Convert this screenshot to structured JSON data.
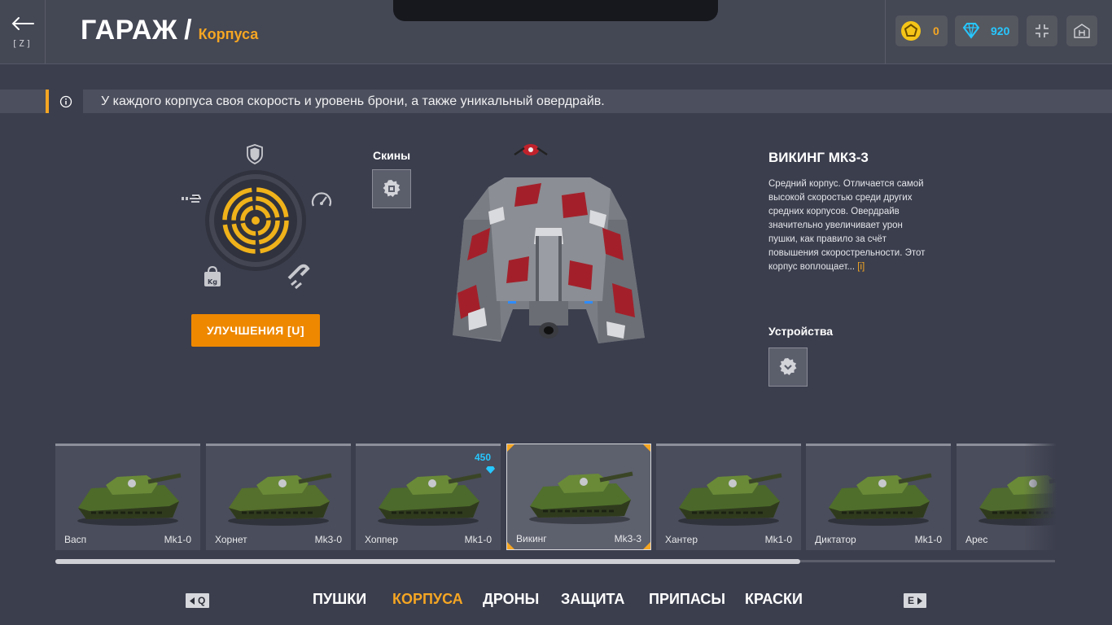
{
  "header": {
    "back_key": "[Z]",
    "title": "ГАРАЖ",
    "title_separator": "/",
    "subtitle": "Корпуса",
    "stars_value": "0",
    "crystals_value": "920"
  },
  "info": {
    "text": "У каждого корпуса своя скорость и уровень брони, а также уникальный овердрайв."
  },
  "upgrades": {
    "label": "УЛУЧШЕНИЯ [U]"
  },
  "skins": {
    "label": "Скины"
  },
  "hull": {
    "name": "ВИКИНГ МК3-3",
    "description": "Средний корпус. Отличается самой высокой скоростью среди других средних корпусов. Овердрайв значительно увеличивает урон пушки, как правило за счёт повышения скорострельности. Этот корпус воплощает...",
    "more": "[i]"
  },
  "devices": {
    "label": "Устройства"
  },
  "cards": [
    {
      "name": "Васп",
      "mk": "Mk1-0",
      "color": "#4e6b2a"
    },
    {
      "name": "Хорнет",
      "mk": "Mk3-0",
      "color": "#556f2c"
    },
    {
      "name": "Хоппер",
      "mk": "Mk1-0",
      "color": "#4c6a2b",
      "price": "450"
    },
    {
      "name": "Викинг",
      "mk": "Mk3-3",
      "color": "#50702c",
      "selected": true
    },
    {
      "name": "Хантер",
      "mk": "Mk1-0",
      "color": "#4b682a"
    },
    {
      "name": "Диктатор",
      "mk": "Mk1-0",
      "color": "#4f6e2b"
    },
    {
      "name": "Арес",
      "mk": "",
      "color": "#506b2e"
    }
  ],
  "nav": {
    "prev_key": "Q",
    "next_key": "E",
    "tabs": [
      "ПУШКИ",
      "КОРПУСА",
      "ДРОНЫ",
      "ЗАЩИТА",
      "ПРИПАСЫ",
      "КРАСКИ"
    ],
    "active": "КОРПУСА"
  },
  "colors": {
    "accent": "#f5a623",
    "crystal": "#27c7ff",
    "button": "#ee8800"
  }
}
